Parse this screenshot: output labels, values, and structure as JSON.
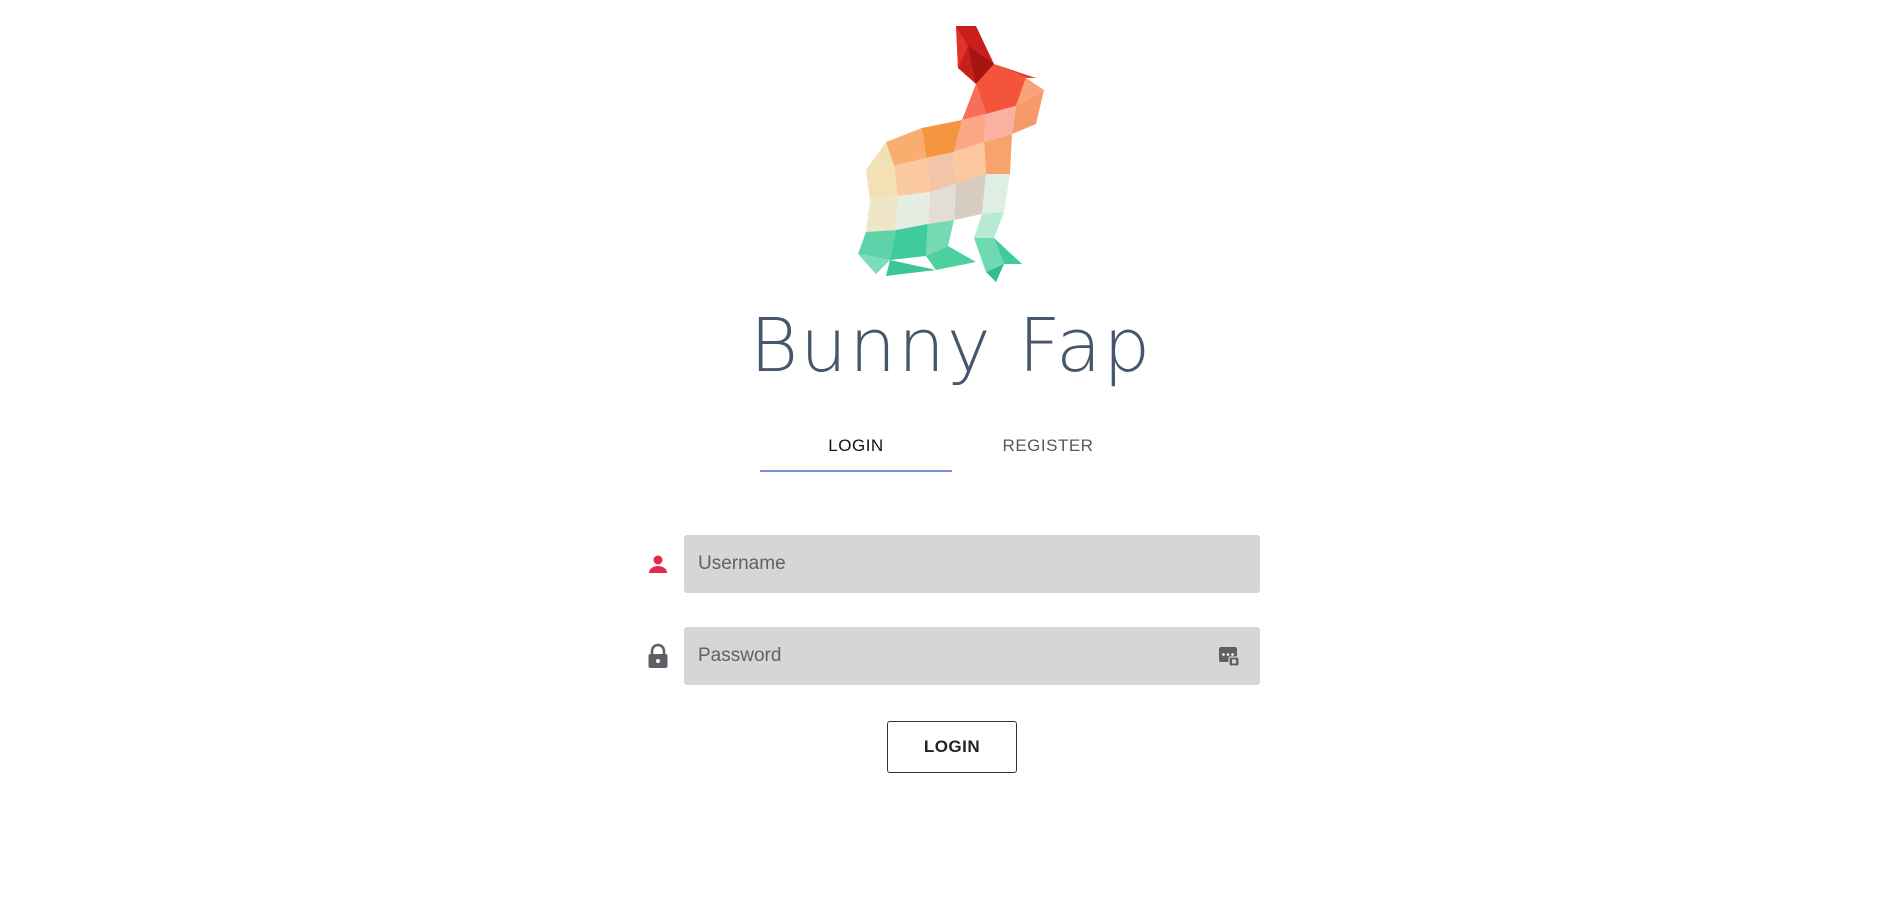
{
  "app": {
    "title": "Bunny Fap"
  },
  "logo": {
    "icon": "bunny-logo",
    "colors": {
      "red": "#d7322b",
      "orange": "#f7943a",
      "peach": "#fcbf96",
      "cream": "#efe3bd",
      "mint": "#9fe3c9",
      "green": "#3fcb9b"
    }
  },
  "tabs": [
    {
      "label": "LOGIN",
      "active": true
    },
    {
      "label": "REGISTER",
      "active": false
    }
  ],
  "form": {
    "username": {
      "placeholder": "Username",
      "value": "",
      "icon": "person-icon"
    },
    "password": {
      "placeholder": "Password",
      "value": "",
      "icon": "lock-icon",
      "toggle_icon": "password-manager-icon"
    },
    "submit_label": "LOGIN"
  },
  "colors": {
    "title": "#47566e",
    "tab_indicator": "#7b8fd6",
    "person_icon": "#e8284a",
    "lock_icon": "#5d6166",
    "field_bg": "#d6d6d6"
  }
}
